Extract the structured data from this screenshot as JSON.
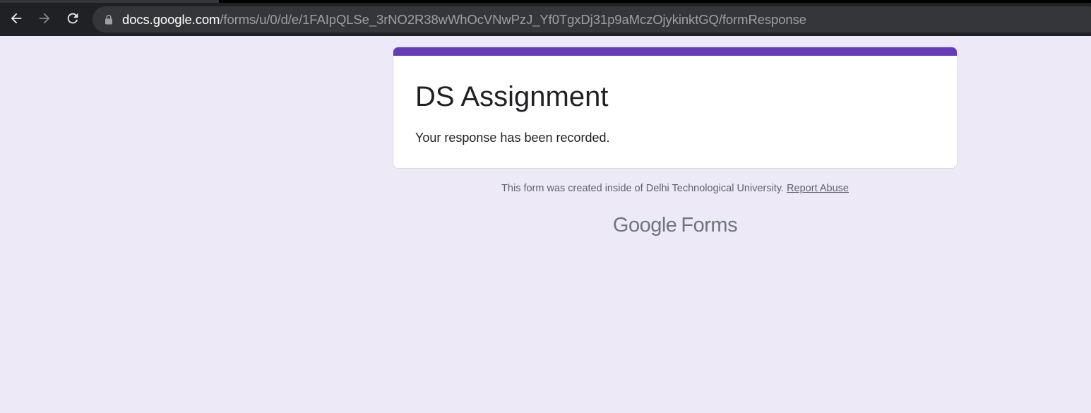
{
  "browser": {
    "url_host": "docs.google.com",
    "url_path": "/forms/u/0/d/e/1FAIpQLSe_3rNO2R38wWhOcVNwPzJ_Yf0TgxDj31p9aMczOjykinktGQ/formResponse",
    "icons": [
      "back-arrow-icon",
      "forward-arrow-icon",
      "reload-icon",
      "lock-icon"
    ]
  },
  "form": {
    "title": "DS Assignment",
    "confirmation": "Your response has been recorded.",
    "accent_color": "#673ab7",
    "background_color": "#ede9f7"
  },
  "footer": {
    "note": "This form was created inside of Delhi Technological University.",
    "report_link": "Report Abuse"
  },
  "branding": {
    "google": "Google",
    "forms": "Forms"
  }
}
